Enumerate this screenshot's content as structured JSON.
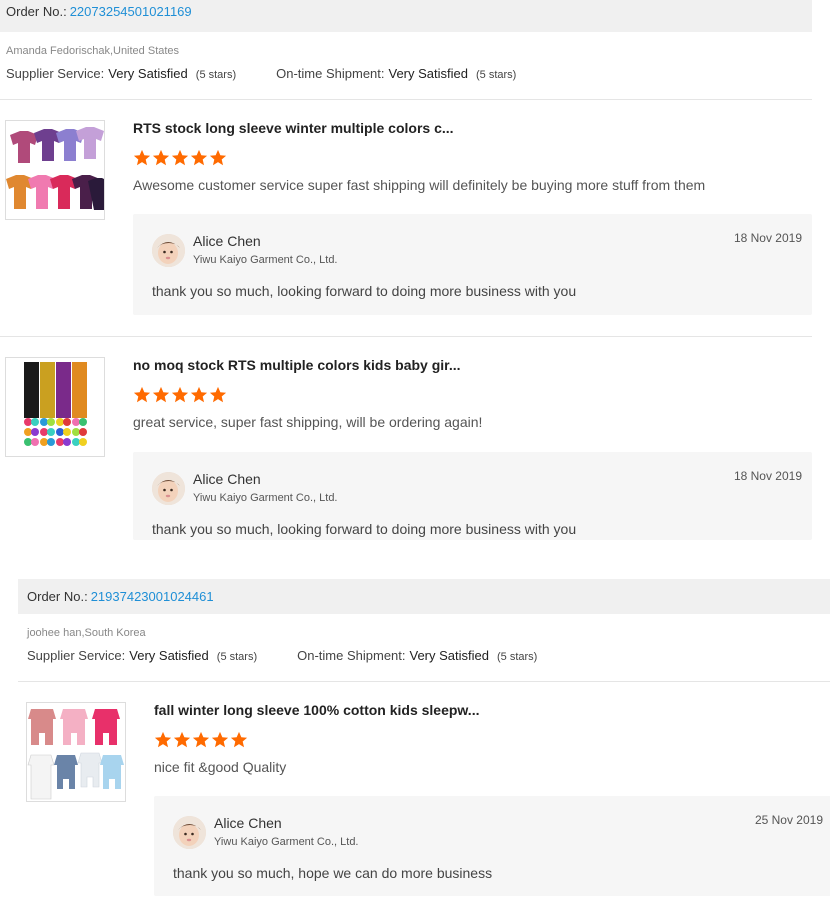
{
  "orders": [
    {
      "order_label": "Order No.:",
      "order_no": "22073254501021169",
      "buyer": "Amanda Fedorischak,United States",
      "supplier_service_label": "Supplier Service:",
      "supplier_service_value": "Very Satisfied",
      "supplier_service_stars": "(5 stars)",
      "shipment_label": "On-time Shipment:",
      "shipment_value": "Very Satisfied",
      "shipment_stars": "(5 stars)",
      "reviews": [
        {
          "title": "RTS stock long sleeve winter multiple colors c...",
          "rating": 5,
          "text": "Awesome customer service super fast shipping will definitely be buying more stuff from them",
          "reply": {
            "name": "Alice Chen",
            "company": "Yiwu Kaiyo Garment Co., Ltd.",
            "date": "18 Nov 2019",
            "text": "thank you so much, looking forward  to doing more business with you"
          }
        },
        {
          "title": "no moq stock RTS multiple colors kids baby gir...",
          "rating": 5,
          "text": "great service, super fast shipping,  will be ordering again!",
          "reply": {
            "name": "Alice Chen",
            "company": "Yiwu Kaiyo Garment Co., Ltd.",
            "date": "18 Nov 2019",
            "text": "thank you so much, looking forward  to doing more business with you"
          }
        }
      ]
    },
    {
      "order_label": "Order No.:",
      "order_no": "21937423001024461",
      "buyer": "joohee han,South Korea",
      "supplier_service_label": "Supplier Service:",
      "supplier_service_value": "Very Satisfied",
      "supplier_service_stars": "(5 stars)",
      "shipment_label": "On-time Shipment:",
      "shipment_value": "Very Satisfied",
      "shipment_stars": "(5 stars)",
      "reviews": [
        {
          "title": "fall winter long sleeve 100% cotton kids sleepw...",
          "rating": 5,
          "text": "nice fit &good Quality",
          "reply": {
            "name": "Alice Chen",
            "company": "Yiwu Kaiyo Garment Co., Ltd.",
            "date": "25 Nov 2019",
            "text": "thank you so much, hope we can do more business"
          }
        }
      ]
    }
  ],
  "colors": {
    "order_link": "#1f8fd6",
    "star": "#ff6a00",
    "header_bg": "#f0f0f0",
    "reply_bg": "#f6f6f6"
  },
  "icons": {
    "star": "star-icon",
    "avatar": "avatar"
  }
}
